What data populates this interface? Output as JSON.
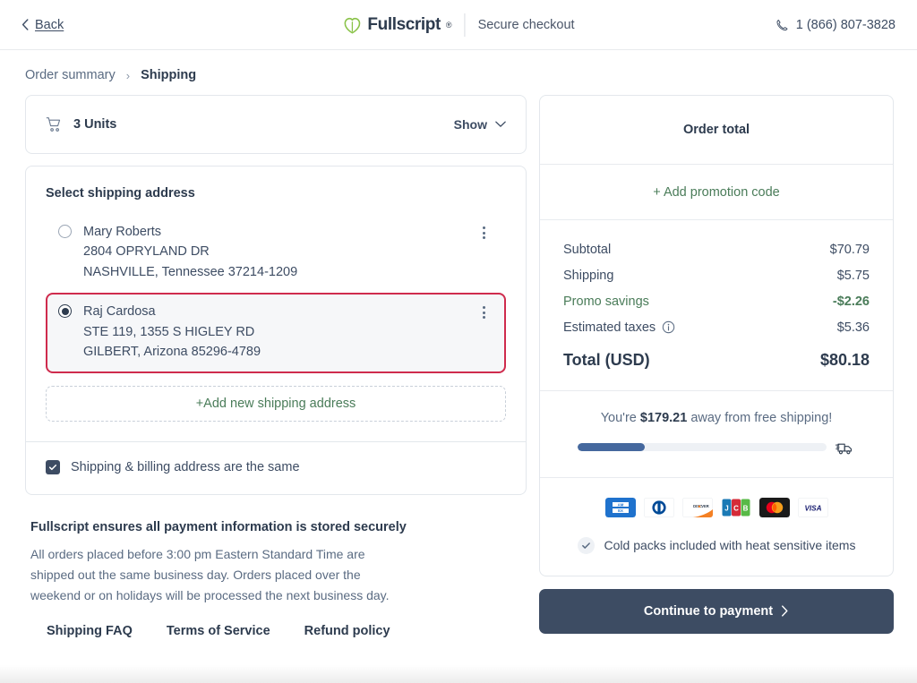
{
  "header": {
    "back_label": "Back",
    "brand_name": "Fullscript",
    "brand_tm": "®",
    "secure_label": "Secure checkout",
    "phone": "1 (866) 807-3828"
  },
  "breadcrumb": {
    "step_previous": "Order summary",
    "separator": "›",
    "step_current": "Shipping"
  },
  "cart": {
    "units_label": "3 Units",
    "show_label": "Show"
  },
  "shipping": {
    "section_title": "Select shipping address",
    "addresses": [
      {
        "name": "Mary Roberts",
        "line1": "2804 OPRYLAND DR",
        "line2": "NASHVILLE, Tennessee 37214-1209",
        "selected": false
      },
      {
        "name": "Raj Cardosa",
        "line1": "STE 119, 1355 S HIGLEY RD",
        "line2": "GILBERT, Arizona 85296-4789",
        "selected": true
      }
    ],
    "add_address_label": "+Add new shipping address",
    "same_address_label": "Shipping & billing address are the same",
    "same_address_checked": true,
    "selected_highlight_color": "#cf2b4d"
  },
  "footer": {
    "title": "Fullscript ensures all payment information is stored securely",
    "body": "All orders placed before 3:00 pm Eastern Standard Time are shipped out the same business day. Orders placed over the weekend or on holidays will be processed the next business day.",
    "links": [
      "Shipping FAQ",
      "Terms of Service",
      "Refund policy"
    ]
  },
  "order_total": {
    "heading": "Order total",
    "promo_label": "+ Add promotion code",
    "rows": [
      {
        "label": "Subtotal",
        "value": "$70.79"
      },
      {
        "label": "Shipping",
        "value": "$5.75"
      },
      {
        "label": "Promo savings",
        "value": "-$2.26"
      },
      {
        "label": "Estimated taxes",
        "value": "$5.36"
      }
    ],
    "grand_label": "Total (USD)",
    "grand_value": "$80.18",
    "promo_color": "#4a7c59"
  },
  "free_shipping": {
    "prefix": "You're ",
    "amount": "$179.21",
    "suffix": " away from free shipping!",
    "progress_percent": 27,
    "fill_color": "#45689e"
  },
  "payment_methods": [
    "amex-card-icon",
    "diners-club-card-icon",
    "discover-card-icon",
    "jcb-card-icon",
    "mastercard-card-icon",
    "visa-card-icon"
  ],
  "cold_packs": {
    "label": "Cold packs included with heat sensitive items"
  },
  "cta": {
    "label": "Continue to payment"
  }
}
